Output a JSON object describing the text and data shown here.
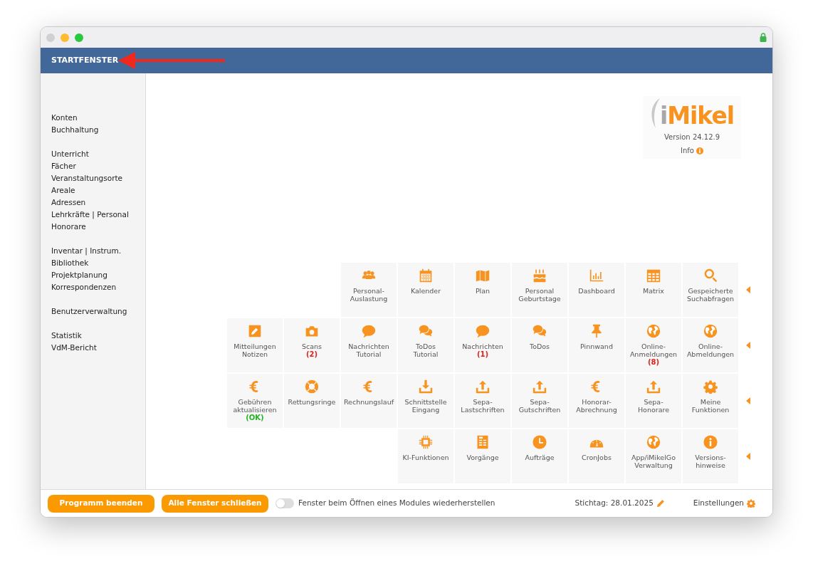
{
  "window": {
    "traffic_lights": [
      {
        "color": "#d0d0d0"
      },
      {
        "color": "#febc2e"
      },
      {
        "color": "#28c840"
      }
    ]
  },
  "header": {
    "title": "STARTFENSTER"
  },
  "sidebar": {
    "groups": [
      {
        "items": [
          "Konten",
          "Buchhaltung"
        ]
      },
      {
        "items": [
          "Unterricht",
          "Fächer",
          "Veranstaltungsorte",
          "Areale",
          "Adressen",
          "Lehrkräfte | Personal",
          "Honorare"
        ]
      },
      {
        "items": [
          "Inventar | Instrum.",
          "Bibliothek",
          "Projektplanung",
          "Korrespondenzen"
        ]
      },
      {
        "items": [
          "Benutzerverwaltung"
        ]
      },
      {
        "items": [
          "Statistik",
          "VdM-Bericht"
        ]
      }
    ]
  },
  "about": {
    "logo": [
      "i",
      "Mikel"
    ],
    "version": "Version 24.12.9",
    "info": "Info"
  },
  "tile_rows": [
    {
      "tiles": [
        {
          "label": "Personal-\nAuslastung"
        },
        {
          "label": "Kalender"
        },
        {
          "label": "Plan"
        },
        {
          "label": "Personal\nGeburtstage"
        },
        {
          "label": "Dashboard"
        },
        {
          "label": "Matrix"
        },
        {
          "label": "Gespeicherte\nSuchabfragen"
        }
      ]
    },
    {
      "tiles": [
        {
          "label": "Mitteilungen\nNotizen"
        },
        {
          "label": "Scans",
          "badge": {
            "text": "(2)",
            "color": "#e0201b"
          }
        },
        {
          "label": "Nachrichten\nTutorial"
        },
        {
          "label": "ToDos\nTutorial"
        },
        {
          "label": "Nachrichten",
          "badge": {
            "text": "(1)",
            "color": "#e0201b"
          }
        },
        {
          "label": "ToDos"
        },
        {
          "label": "Pinnwand"
        },
        {
          "label": "Online-\nAnmeldungen",
          "badge": {
            "text": "(8)",
            "color": "#e0201b"
          }
        },
        {
          "label": "Online-\nAbmeldungen"
        }
      ]
    },
    {
      "tiles": [
        {
          "label": "Gebühren\naktualisieren",
          "badge": {
            "text": "(OK)",
            "color": "#22b422"
          }
        },
        {
          "label": "Rettungsringe"
        },
        {
          "label": "Rechnungslauf"
        },
        {
          "label": "Schnittstelle\nEingang"
        },
        {
          "label": "Sepa-\nLastschriften"
        },
        {
          "label": "Sepa-\nGutschriften"
        },
        {
          "label": "Honorar-\nAbrechnung"
        },
        {
          "label": "Sepa-\nHonorare"
        },
        {
          "label": "Meine\nFunktionen"
        }
      ]
    },
    {
      "tiles": [
        {
          "label": "KI-Funktionen"
        },
        {
          "label": "Vorgänge"
        },
        {
          "label": "Aufträge"
        },
        {
          "label": "CronJobs"
        },
        {
          "label": "App/iMikelGo\nVerwaltung"
        },
        {
          "label": "Versions-\nhinweise"
        }
      ]
    }
  ],
  "footer": {
    "buttons": [
      "Programm beenden",
      "Alle Fenster schließen"
    ],
    "toggle": {
      "label": "Fenster beim Öffnen eines Modules wiederherstellen",
      "on": false
    },
    "date": "Stichtag: 28.01.2025",
    "settings": "Einstellungen"
  }
}
